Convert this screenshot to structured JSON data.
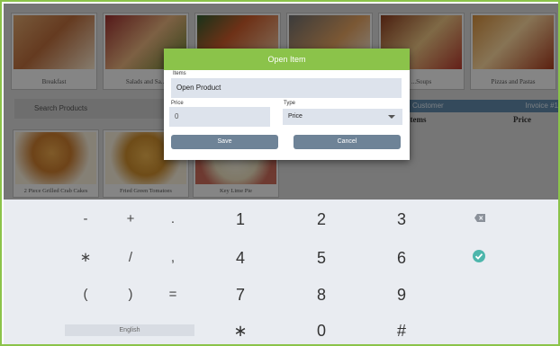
{
  "app": {
    "categories": [
      {
        "label": "Breakfast"
      },
      {
        "label": "Salads and Sa..."
      },
      {
        "label": ""
      },
      {
        "label": ""
      },
      {
        "label": "...Soups"
      },
      {
        "label": "Pizzas and Pastas"
      }
    ],
    "search_placeholder": "Search Products",
    "products": [
      {
        "label": "2 Piece Grilled Crab Cakes"
      },
      {
        "label": "Fried Green Tomatoes"
      },
      {
        "label": "Key Lime Pie"
      }
    ],
    "customer_label": "Customer",
    "customer_right": "Invoice #1",
    "col_items": "Items",
    "col_price": "Price"
  },
  "dialog": {
    "title": "Open Item",
    "items_label": "Items",
    "items_value": "Open Product",
    "price_label": "Price",
    "price_value": "0",
    "type_label": "Type",
    "type_value": "Price",
    "save_label": "Save",
    "cancel_label": "Cancel"
  },
  "keyboard": {
    "row1": [
      "-",
      "+",
      ".",
      "1",
      "2",
      "3"
    ],
    "row2": [
      "∗",
      "/",
      ",",
      "4",
      "5",
      "6"
    ],
    "row3": [
      "(",
      ")",
      "=",
      "7",
      "8",
      "9"
    ],
    "row4": [
      "∗",
      "0",
      "#"
    ],
    "language": "English",
    "icons": {
      "backspace": "backspace-icon",
      "done": "check-circle-icon"
    },
    "colors": {
      "done": "#4db6ac",
      "accent": "#8bc34a"
    }
  }
}
